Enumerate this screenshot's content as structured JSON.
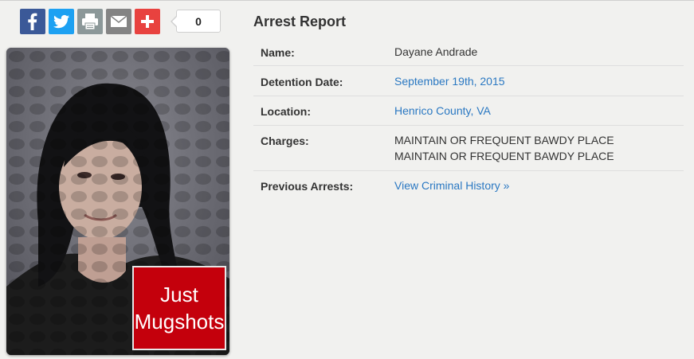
{
  "share": {
    "buttons": [
      {
        "name": "facebook",
        "icon": "facebook-icon",
        "color": "#3b5998"
      },
      {
        "name": "twitter",
        "icon": "twitter-icon",
        "color": "#1da1f2"
      },
      {
        "name": "print",
        "icon": "printer-icon",
        "color": "#8c9899"
      },
      {
        "name": "email",
        "icon": "envelope-icon",
        "color": "#848484"
      },
      {
        "name": "more",
        "icon": "plus-icon",
        "color": "#e8423f"
      }
    ],
    "count": "0"
  },
  "photo": {
    "logo_line1": "Just",
    "logo_line2": "Mugshots",
    "logo_color": "#c4000c"
  },
  "report": {
    "title": "Arrest Report",
    "name_label": "Name:",
    "name_value": "Dayane Andrade",
    "date_label": "Detention Date:",
    "date_value": "September 19th, 2015",
    "location_label": "Location:",
    "location_value": "Henrico County, VA",
    "charges_label": "Charges:",
    "charges": [
      "MAINTAIN OR FREQUENT BAWDY PLACE",
      "MAINTAIN OR FREQUENT BAWDY PLACE"
    ],
    "previous_label": "Previous Arrests:",
    "previous_value": "View Criminal History »",
    "link_color": "#2a78c2"
  }
}
